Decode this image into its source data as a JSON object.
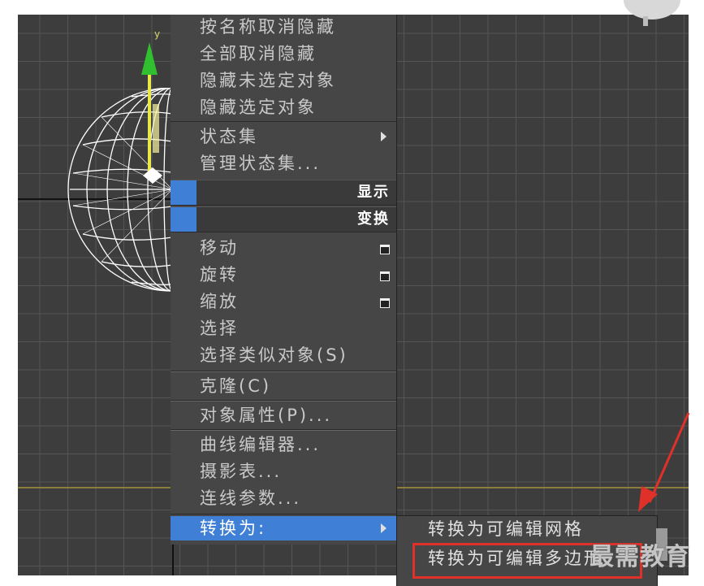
{
  "viewport": {
    "axis_label_y": "y"
  },
  "menu": {
    "items_top": [
      {
        "label": "按名称取消隐藏"
      },
      {
        "label": "全部取消隐藏"
      },
      {
        "label": "隐藏未选定对象"
      },
      {
        "label": "隐藏选定对象"
      },
      {
        "label": "状态集"
      },
      {
        "label": "管理状态集..."
      }
    ],
    "section_display": "显示",
    "section_transform": "变换",
    "items_transform": [
      {
        "label": "移动"
      },
      {
        "label": "旋转"
      },
      {
        "label": "缩放"
      },
      {
        "label": "选择"
      },
      {
        "label": "选择类似对象(S)"
      }
    ],
    "clone": "克隆(C)",
    "object_properties": "对象属性(P)...",
    "items_tools": [
      {
        "label": "曲线编辑器..."
      },
      {
        "label": "摄影表..."
      },
      {
        "label": "连线参数..."
      }
    ],
    "convert_to": "转换为:"
  },
  "submenu": {
    "items": [
      {
        "label": "转换为可编辑网格"
      },
      {
        "label": "转换为可编辑多边形"
      }
    ]
  },
  "watermark": "最需教育",
  "colors": {
    "menu_bg": "#464646",
    "highlight": "#3f7fd6",
    "viewport_bg": "#3d3d3d",
    "annotation": "#e0302a"
  }
}
